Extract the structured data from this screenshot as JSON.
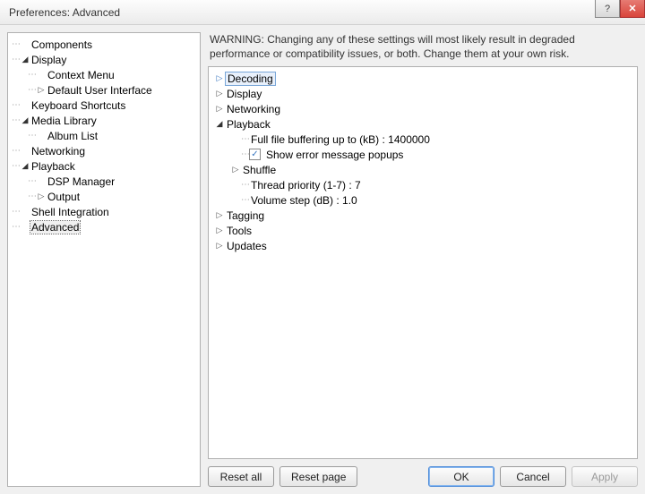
{
  "window": {
    "title": "Preferences: Advanced"
  },
  "sidebar": {
    "items": [
      {
        "label": "Components",
        "depth": 0,
        "expand": null
      },
      {
        "label": "Display",
        "depth": 0,
        "expand": "open"
      },
      {
        "label": "Context Menu",
        "depth": 1,
        "expand": null
      },
      {
        "label": "Default User Interface",
        "depth": 1,
        "expand": "closed"
      },
      {
        "label": "Keyboard Shortcuts",
        "depth": 0,
        "expand": null
      },
      {
        "label": "Media Library",
        "depth": 0,
        "expand": "open"
      },
      {
        "label": "Album List",
        "depth": 1,
        "expand": null
      },
      {
        "label": "Networking",
        "depth": 0,
        "expand": null
      },
      {
        "label": "Playback",
        "depth": 0,
        "expand": "open"
      },
      {
        "label": "DSP Manager",
        "depth": 1,
        "expand": null
      },
      {
        "label": "Output",
        "depth": 1,
        "expand": "closed"
      },
      {
        "label": "Shell Integration",
        "depth": 0,
        "expand": null
      },
      {
        "label": "Advanced",
        "depth": 0,
        "expand": null,
        "selected": true
      }
    ]
  },
  "warning": "WARNING: Changing any of these settings will most likely result in degraded performance or compatibility issues, or both. Change them at your own risk.",
  "settings": {
    "items": [
      {
        "label": "Decoding",
        "depth": 0,
        "expand": "closed",
        "selected": true
      },
      {
        "label": "Display",
        "depth": 0,
        "expand": "closed"
      },
      {
        "label": "Networking",
        "depth": 0,
        "expand": "closed"
      },
      {
        "label": "Playback",
        "depth": 0,
        "expand": "open"
      },
      {
        "label": "Full file buffering up to (kB) : 1400000",
        "depth": 1,
        "expand": null
      },
      {
        "label": "Show error message popups",
        "depth": 1,
        "expand": null,
        "checkbox": true,
        "checked": true
      },
      {
        "label": "Shuffle",
        "depth": 1,
        "expand": "closed"
      },
      {
        "label": "Thread priority (1-7) : 7",
        "depth": 1,
        "expand": null
      },
      {
        "label": "Volume step (dB) : 1.0",
        "depth": 1,
        "expand": null
      },
      {
        "label": "Tagging",
        "depth": 0,
        "expand": "closed"
      },
      {
        "label": "Tools",
        "depth": 0,
        "expand": "closed"
      },
      {
        "label": "Updates",
        "depth": 0,
        "expand": "closed"
      }
    ]
  },
  "buttons": {
    "reset_all": "Reset all",
    "reset_page": "Reset page",
    "ok": "OK",
    "cancel": "Cancel",
    "apply": "Apply"
  }
}
